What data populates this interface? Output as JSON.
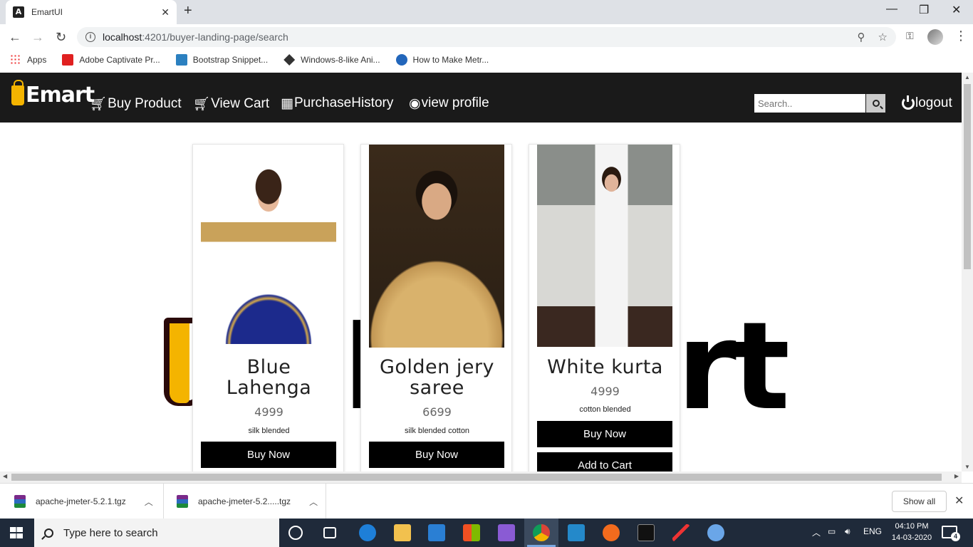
{
  "browser": {
    "tab_title": "EmartUI",
    "tab_favicon_letter": "A",
    "url_host": "localhost",
    "url_path": ":4201/buyer-landing-page/search",
    "bookmarks": [
      {
        "label": "Apps"
      },
      {
        "label": "Adobe Captivate Pr..."
      },
      {
        "label": "Bootstrap Snippet..."
      },
      {
        "label": "Windows-8-like Ani..."
      },
      {
        "label": "How to Make Metr..."
      }
    ]
  },
  "app": {
    "brand": "Emart",
    "nav": [
      {
        "label": "Buy Product",
        "icon": "cart-icon"
      },
      {
        "label": "View Cart",
        "icon": "cart-icon"
      },
      {
        "label": "PurchaseHistory",
        "icon": "calendar-icon"
      },
      {
        "label": "view profile",
        "icon": "eye-icon"
      }
    ],
    "search_placeholder": "Search..",
    "logout_label": "logout",
    "background_logo": "Emart",
    "products": [
      {
        "name": "Blue Lahenga",
        "name_line1": "Blue",
        "name_line2": "Lahenga",
        "price": "4999",
        "description": "silk blended",
        "buy_label": "Buy Now"
      },
      {
        "name": "Golden jery saree",
        "name_line1": "Golden jery",
        "name_line2": "saree",
        "price": "6699",
        "description": "silk blended cotton",
        "buy_label": "Buy Now"
      },
      {
        "name": "White kurta",
        "price": "4999",
        "description": "cotton blended",
        "buy_label": "Buy Now",
        "cart_label": "Add to Cart"
      }
    ]
  },
  "downloads": {
    "items": [
      {
        "filename": "apache-jmeter-5.2.1.tgz"
      },
      {
        "filename": "apache-jmeter-5.2.....tgz"
      }
    ],
    "show_all": "Show all"
  },
  "taskbar": {
    "search_placeholder": "Type here to search",
    "language": "ENG",
    "time": "04:10 PM",
    "date": "14-03-2020",
    "notification_count": "4"
  }
}
